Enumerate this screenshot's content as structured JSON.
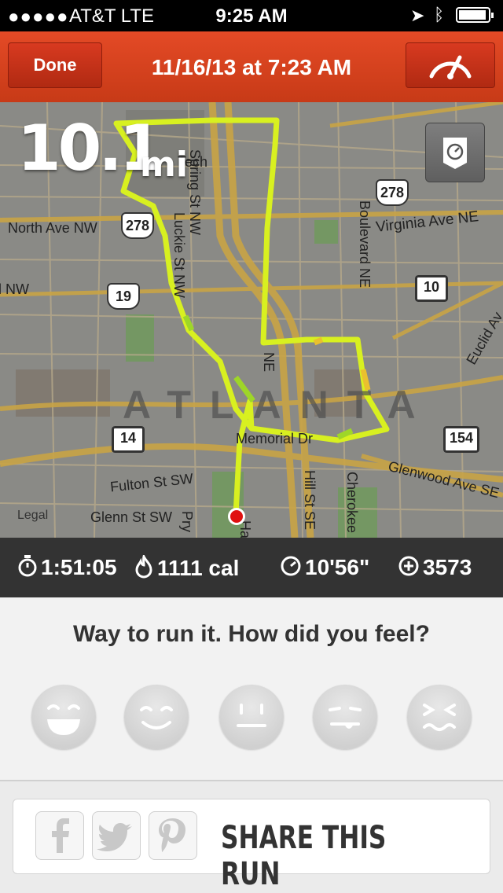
{
  "status_bar": {
    "signal": "●●●●●",
    "carrier": "AT&T  LTE",
    "time": "9:25 AM",
    "battery_level": 0.95
  },
  "header": {
    "done_label": "Done",
    "title": "11/16/13 at 7:23 AM",
    "gauge_icon": "speedometer-icon"
  },
  "map": {
    "distance_value": "10.1",
    "distance_unit": "mi",
    "city_label": "ATLANTA",
    "legal_label": "Legal",
    "street_labels": {
      "virginia": "Virginia Ave NE",
      "north_ave": "North Ave NW",
      "nw": "d NW",
      "spring": "Spring St NW",
      "luckie": "Luckie St NW",
      "boulevard": "Boulevard NE",
      "euclid": "Euclid Av",
      "memorial": "Memorial Dr",
      "fulton": "Fulton St SW",
      "glenn": "Glenn St SW",
      "glenwood": "Glenwood Ave SE",
      "hill": "Hill St SE",
      "cherokee": "Cherokee",
      "tech": "Tech",
      "pry": "Pry",
      "ne": "NE",
      "ha": "Ha"
    },
    "route_shields": [
      "278",
      "278",
      "19",
      "10",
      "14",
      "154"
    ],
    "route_line_color": "#d8f020"
  },
  "stats": {
    "duration": "1:51:05",
    "calories": "1111 cal",
    "pace": "10'56\"",
    "fuel": "3573"
  },
  "feel": {
    "prompt": "Way to run it. How did you feel?",
    "faces": [
      "face-great-icon",
      "face-good-icon",
      "face-ok-icon",
      "face-meh-icon",
      "face-bad-icon"
    ]
  },
  "share": {
    "label": "SHARE THIS RUN",
    "networks": [
      "facebook-icon",
      "twitter-icon",
      "pinterest-icon"
    ]
  }
}
